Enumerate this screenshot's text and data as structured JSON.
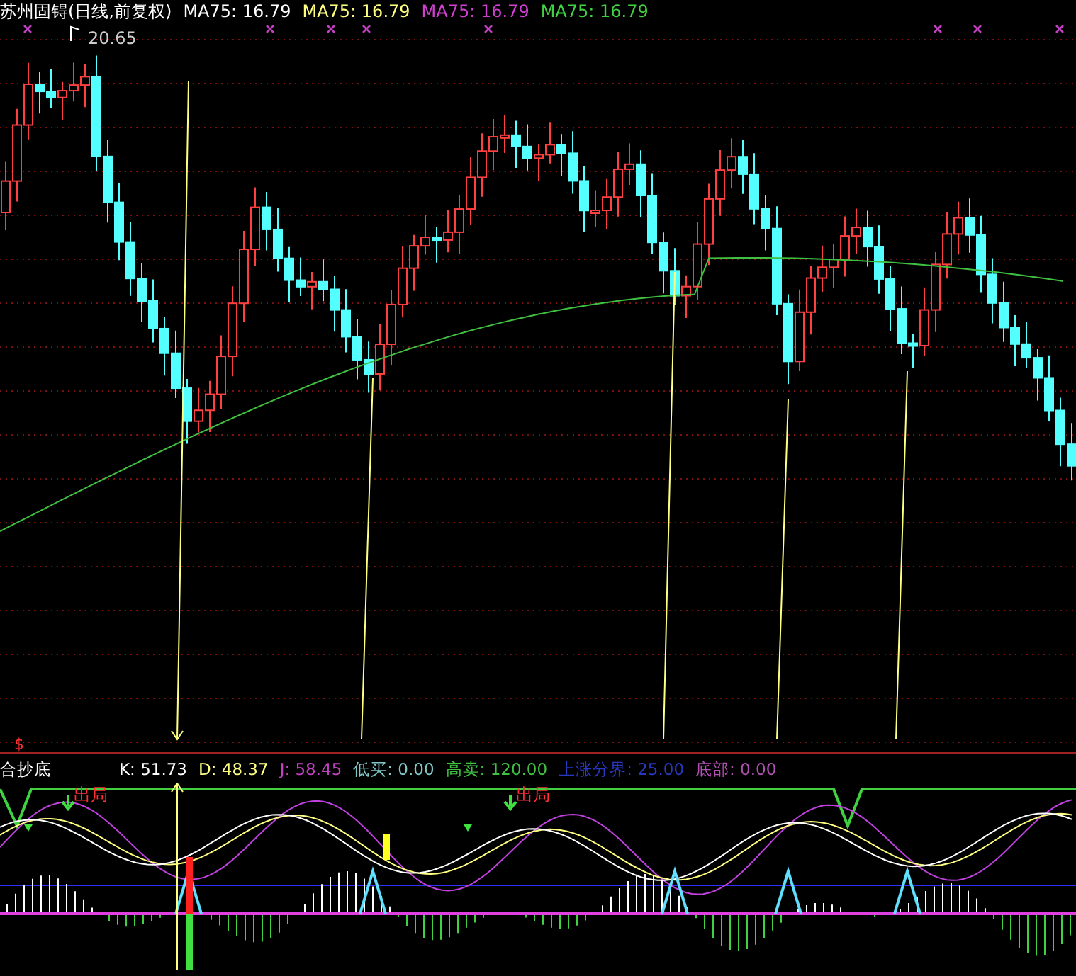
{
  "chart": {
    "title": "苏州固锝(日线,前复权)",
    "ma_legend": [
      {
        "label": "MA75: 16.79",
        "color": "#ffffff"
      },
      {
        "label": "MA75: 16.79",
        "color": "#ffff80"
      },
      {
        "label": "MA75: 16.79",
        "color": "#d040d0"
      },
      {
        "label": "MA75: 16.79",
        "color": "#40d040"
      }
    ],
    "high_label": "20.65",
    "signal_mark": "$"
  },
  "indicator": {
    "name": "合抄底",
    "legend": [
      {
        "label": "K: 51.73",
        "color": "#ffffff"
      },
      {
        "label": "D: 48.37",
        "color": "#ffff80"
      },
      {
        "label": "J: 58.45",
        "color": "#c040c0"
      },
      {
        "label": "低买: 0.00",
        "color": "#80c8c8"
      },
      {
        "label": "高卖: 120.00",
        "color": "#40c040"
      },
      {
        "label": "上涨分界: 25.00",
        "color": "#2838c0"
      },
      {
        "label": "底部: 0.00",
        "color": "#b050b0"
      }
    ],
    "signals": [
      "出局",
      "出局"
    ]
  }
}
